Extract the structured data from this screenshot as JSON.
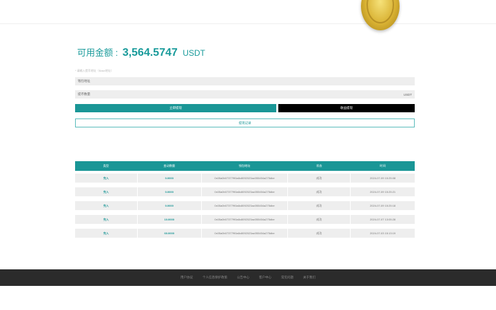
{
  "balance": {
    "label": "可用金额 :",
    "amount": "3,564.5747",
    "unit": "USDT"
  },
  "hint": "* 请输入提币地址（Base地址）",
  "form": {
    "address_label": "钱包地址",
    "amount_label": "提币数量",
    "amount_unit": "USDT"
  },
  "buttons": {
    "primary": "立即提现",
    "secondary": "收益提现",
    "records": "提现记录"
  },
  "table": {
    "headers": [
      "类型",
      "变动数量",
      "钱包地址",
      "状态",
      "时间"
    ],
    "rows": [
      [
        "充入",
        "0.0000",
        "0x05a0b07377f90a8c8092023ac055454a275dbe",
        "成功",
        "2024-07-09 15:25:08"
      ],
      [
        "充入",
        "0.0000",
        "0x05a0b07377f90a8c8092023ac055454a275dbe",
        "成功",
        "2024-07-09 15:25:21"
      ],
      [
        "充入",
        "0.0000",
        "0x05a0b07377f90a8c8092023ac055454a275dbe",
        "成功",
        "2024-07-09 15:25:18"
      ],
      [
        "充入",
        "10.0000",
        "0x05a0b07377f90a8c8092023ac055454a275dbe",
        "成功",
        "2024-07-07 13:05:28"
      ],
      [
        "充入",
        "60.0000",
        "0x05a0b07377f90a8c8092023ac055454a275dbe",
        "成功",
        "2024-07-03 15:13:19"
      ]
    ]
  },
  "footer": {
    "links": [
      "用户协议",
      "个人信息保护政策",
      "公告中心",
      "客户中心",
      "常见问题",
      "关于我们"
    ]
  },
  "colors": {
    "accent": "#1a9696",
    "footer_bg": "#2b2b2b"
  }
}
